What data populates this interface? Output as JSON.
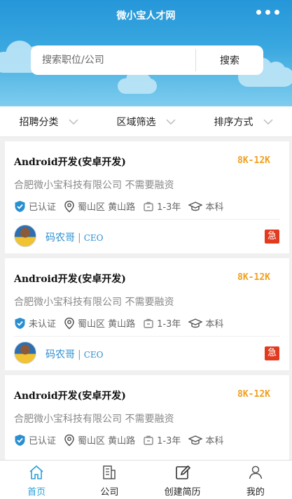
{
  "header": {
    "title": "微小宝人才网",
    "more_icon": "more-dots-icon"
  },
  "search": {
    "placeholder": "搜索职位/公司",
    "button_label": "搜索"
  },
  "filters": [
    {
      "label": "招聘分类",
      "icon": "chevron-down-icon"
    },
    {
      "label": "区域筛选",
      "icon": "chevron-down-icon"
    },
    {
      "label": "排序方式",
      "icon": "chevron-down-icon"
    }
  ],
  "jobs": [
    {
      "title": "Android开发(安卓开发)",
      "salary": "8K-12K",
      "company": "合肥微小宝科技有限公司 不需要融资",
      "verify": "已认证",
      "location": "蜀山区 黄山路",
      "experience": "1-3年",
      "education": "本科",
      "recruiter_name": "码农哥",
      "recruiter_sep": "|",
      "recruiter_role": "CEO",
      "urgent": "急"
    },
    {
      "title": "Android开发(安卓开发)",
      "salary": "8K-12K",
      "company": "合肥微小宝科技有限公司 不需要融资",
      "verify": "未认证",
      "location": "蜀山区 黄山路",
      "experience": "1-3年",
      "education": "本科",
      "recruiter_name": "码农哥",
      "recruiter_sep": "|",
      "recruiter_role": "CEO",
      "urgent": "急"
    },
    {
      "title": "Android开发(安卓开发)",
      "salary": "8K-12K",
      "company": "合肥微小宝科技有限公司 不需要融资",
      "verify": "已认证",
      "location": "蜀山区 黄山路",
      "experience": "1-3年",
      "education": "本科"
    }
  ],
  "nav": [
    {
      "label": "首页",
      "icon": "home-icon",
      "active": true
    },
    {
      "label": "公司",
      "icon": "building-icon",
      "active": false
    },
    {
      "label": "创建简历",
      "icon": "edit-icon",
      "active": false
    },
    {
      "label": "我的",
      "icon": "user-icon",
      "active": false
    }
  ],
  "colors": {
    "accent": "#2aa0d8",
    "salary": "#f0a020",
    "urgent": "#e23a1e",
    "header_top": "#2596d8"
  }
}
